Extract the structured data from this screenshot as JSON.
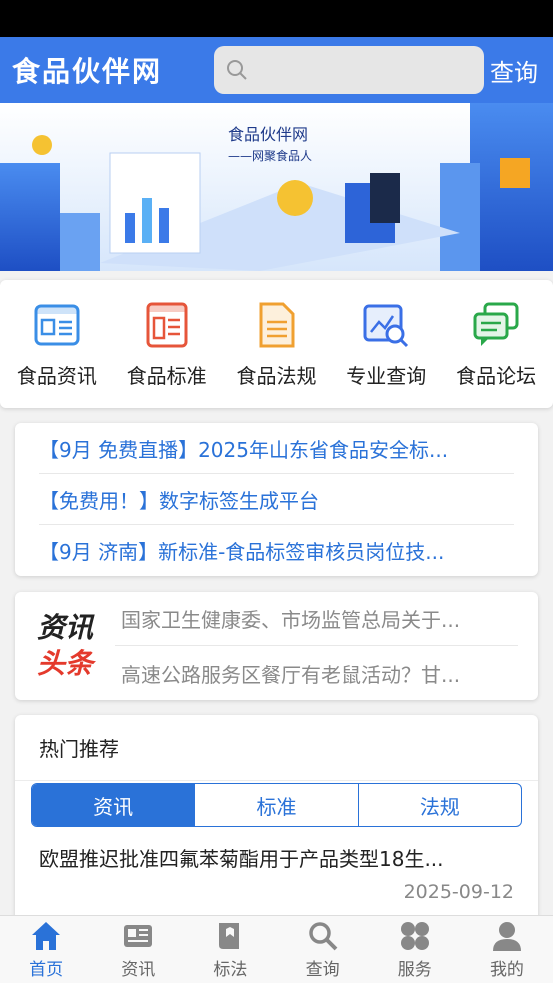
{
  "header": {
    "logo": "食品伙伴网",
    "search_placeholder": "",
    "query_label": "查询"
  },
  "banner": {
    "title": "食品伙伴网",
    "slogan": "——网聚食品人"
  },
  "quick_nav": [
    {
      "label": "食品资讯",
      "icon": "news-card-icon",
      "color": "#3a8ee6"
    },
    {
      "label": "食品标准",
      "icon": "standard-doc-icon",
      "color": "#e6553a"
    },
    {
      "label": "食品法规",
      "icon": "regulation-doc-icon",
      "color": "#f0a030"
    },
    {
      "label": "专业查询",
      "icon": "search-report-icon",
      "color": "#3a6fe6"
    },
    {
      "label": "食品论坛",
      "icon": "forum-chat-icon",
      "color": "#2aa84a"
    }
  ],
  "notices": [
    "【9月 免费直播】2025年山东省食品安全标...",
    "【免费用！】数字标签生成平台",
    "【9月 济南】新标准-食品标签审核员岗位技..."
  ],
  "headlines": {
    "logo_line1": "资讯",
    "logo_line2": "头条",
    "items": [
      "国家卫生健康委、市场监管总局关于...",
      "高速公路服务区餐厅有老鼠活动？甘..."
    ]
  },
  "hot": {
    "title": "热门推荐",
    "tabs": [
      "资讯",
      "标准",
      "法规"
    ],
    "active_tab": 0,
    "article_title": "欧盟推迟批准四氟苯菊酯用于产品类型18生...",
    "article_date": "2025-09-12"
  },
  "tabbar": [
    {
      "label": "首页",
      "icon": "home-icon",
      "active": true
    },
    {
      "label": "资讯",
      "icon": "news-icon",
      "active": false
    },
    {
      "label": "标法",
      "icon": "book-icon",
      "active": false
    },
    {
      "label": "查询",
      "icon": "search-icon",
      "active": false
    },
    {
      "label": "服务",
      "icon": "service-grid-icon",
      "active": false
    },
    {
      "label": "我的",
      "icon": "user-icon",
      "active": false
    }
  ],
  "colors": {
    "primary": "#3b7ae8",
    "link": "#2a72d8",
    "accent_red": "#e43a2c"
  }
}
